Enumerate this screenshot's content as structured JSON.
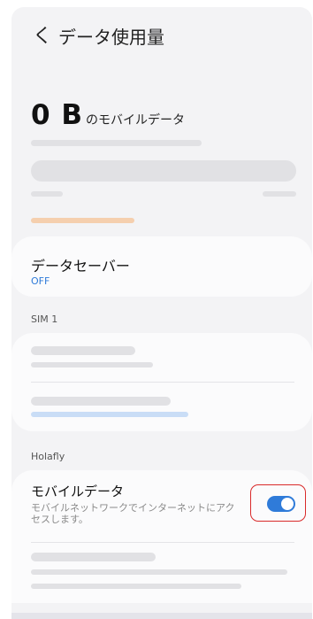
{
  "header": {
    "back_glyph": "く",
    "title": "データ使用量"
  },
  "usage": {
    "amount": "0 B",
    "label": "のモバイルデータ"
  },
  "data_saver": {
    "label": "データセーバー",
    "value": "OFF"
  },
  "sections": {
    "sim": "SIM 1",
    "holafly": "Holafly"
  },
  "mobile_data": {
    "title": "モバイルデータ",
    "subtitle": "モバイルネットワークでインターネットにアクセスします。",
    "enabled": true
  },
  "colors": {
    "accent": "#2f7bd9",
    "highlight_outline": "#d92a2a",
    "progress_orange": "#f5cfae",
    "progress_blue": "#c9ddf6"
  }
}
